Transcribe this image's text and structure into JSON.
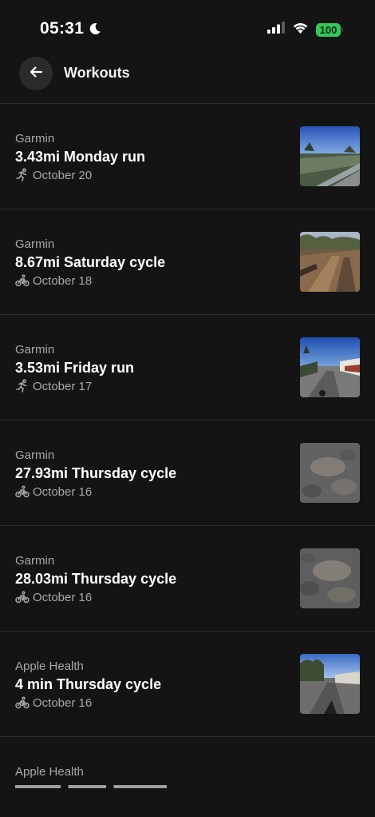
{
  "status_bar": {
    "time": "05:31",
    "battery": "100",
    "icons": [
      "moon-icon",
      "signal-icon",
      "wifi-icon",
      "battery-icon"
    ]
  },
  "header": {
    "title": "Workouts",
    "back_icon": "arrow-left-icon"
  },
  "workouts": [
    {
      "source": "Garmin",
      "title": "3.43mi Monday run",
      "activity": "run",
      "icon": "running-icon",
      "date": "October 20",
      "thumbnail": "road-trail-photo"
    },
    {
      "source": "Garmin",
      "title": "8.67mi Saturday cycle",
      "activity": "cycle",
      "icon": "bike-icon",
      "date": "October 18",
      "thumbnail": "dirt-trail-photo"
    },
    {
      "source": "Garmin",
      "title": "3.53mi Friday run",
      "activity": "run",
      "icon": "running-icon",
      "date": "October 17",
      "thumbnail": "street-photo"
    },
    {
      "source": "Garmin",
      "title": "27.93mi Thursday cycle",
      "activity": "cycle",
      "icon": "bike-icon",
      "date": "October 16",
      "thumbnail": "asphalt-photo"
    },
    {
      "source": "Garmin",
      "title": "28.03mi Thursday cycle",
      "activity": "cycle",
      "icon": "bike-icon",
      "date": "October 16",
      "thumbnail": "asphalt-photo"
    },
    {
      "source": "Apple Health",
      "title": "4 min Thursday cycle",
      "activity": "cycle",
      "icon": "bike-icon",
      "date": "October 16",
      "thumbnail": "street-photo"
    }
  ],
  "partial_item": {
    "source": "Apple Health"
  },
  "colors": {
    "background": "#141414",
    "divider": "#2c2c2c",
    "battery": "#34c759",
    "secondary_text": "#a8a8a8"
  }
}
